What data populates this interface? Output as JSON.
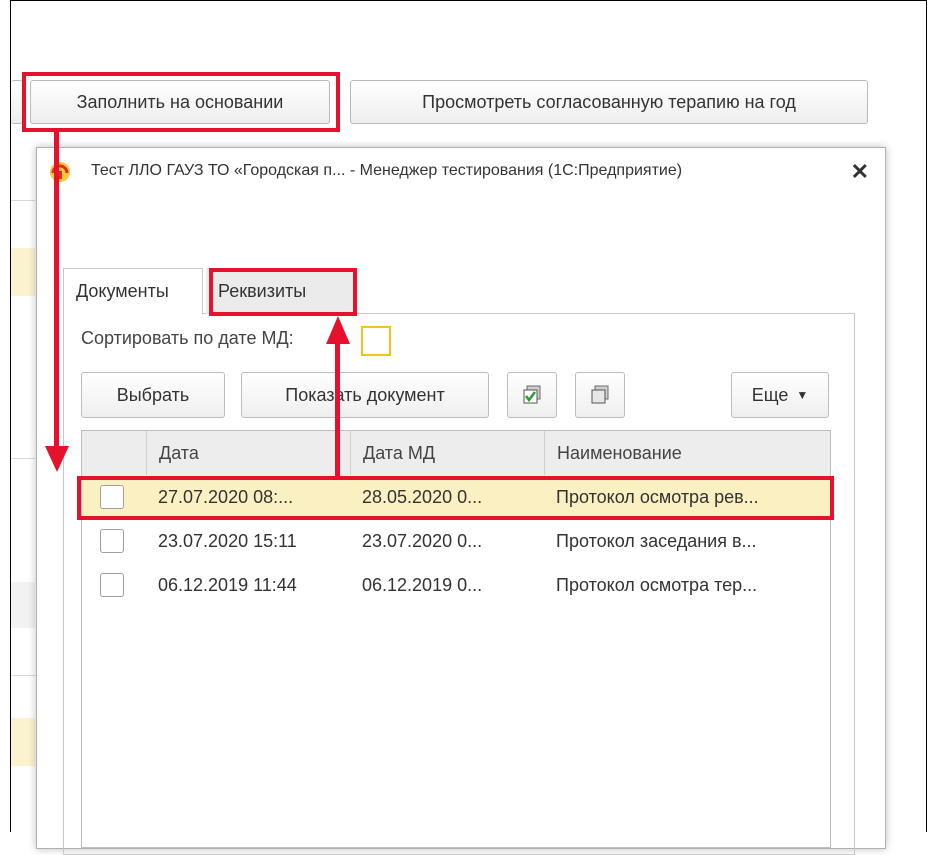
{
  "top_buttons": {
    "fill": "Заполнить на основании",
    "view": "Просмотреть согласованную терапию на год"
  },
  "dialog": {
    "title": "Тест ЛЛО ГАУЗ ТО «Городская п... - Менеджер тестирования (1С:Предприятие)",
    "close": "✕"
  },
  "tabs": {
    "documents": "Документы",
    "requisites": "Реквизиты"
  },
  "sort": {
    "label": "Сортировать по дате МД:"
  },
  "toolbar": {
    "select": "Выбрать",
    "show_document": "Показать документ",
    "more": "Еще"
  },
  "table": {
    "columns": [
      "Дата",
      "Дата МД",
      "Наименование"
    ],
    "rows": [
      {
        "date": "27.07.2020 08:...",
        "date_md": "28.05.2020 0...",
        "name": "Протокол осмотра рев..."
      },
      {
        "date": "23.07.2020 15:11",
        "date_md": "23.07.2020 0...",
        "name": "Протокол заседания в..."
      },
      {
        "date": "06.12.2019 11:44",
        "date_md": "06.12.2019 0...",
        "name": "Протокол осмотра тер..."
      }
    ]
  },
  "colors": {
    "highlight": "#e8112d",
    "selected_row": "#fbf0c2",
    "checkbox_accent": "#f0c419"
  }
}
